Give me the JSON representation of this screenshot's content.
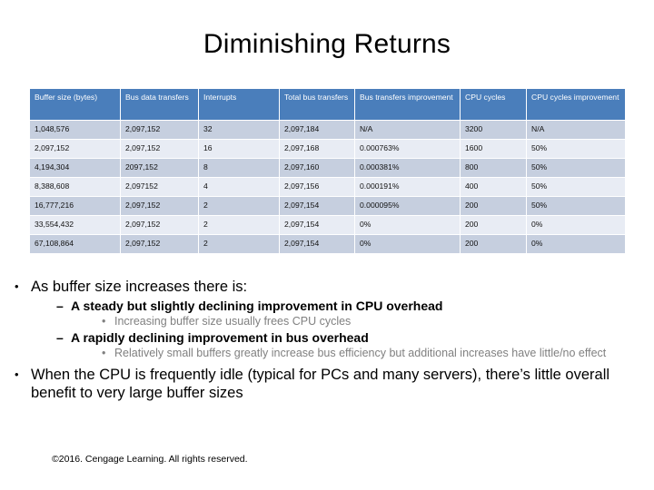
{
  "slide": {
    "title": "Diminishing Returns",
    "footer": "©2016. Cengage Learning. All rights reserved."
  },
  "table": {
    "headers": [
      "Buffer size (bytes)",
      "Bus data transfers",
      "Interrupts",
      "Total bus transfers",
      "Bus transfers improvement",
      "CPU cycles",
      "CPU cycles improvement"
    ],
    "header_colors": {
      "background": "#4a7ebb",
      "text": "#ffffff"
    },
    "row_colors": {
      "odd": "#c6cfdf",
      "even": "#e8ecf4"
    },
    "rows": [
      {
        "buffer_size": "1,048,576",
        "bus_data_transfers": "2,097,152",
        "interrupts": "32",
        "total_bus_transfers": "2,097,184",
        "bus_transfers_improvement": "N/A",
        "cpu_cycles": "3200",
        "cpu_cycles_improvement": "N/A"
      },
      {
        "buffer_size": "2,097,152",
        "bus_data_transfers": "2,097,152",
        "interrupts": "16",
        "total_bus_transfers": "2,097,168",
        "bus_transfers_improvement": "0.000763%",
        "cpu_cycles": "1600",
        "cpu_cycles_improvement": "50%"
      },
      {
        "buffer_size": "4,194,304",
        "bus_data_transfers": "2097,152",
        "interrupts": "8",
        "total_bus_transfers": "2,097,160",
        "bus_transfers_improvement": "0.000381%",
        "cpu_cycles": "800",
        "cpu_cycles_improvement": "50%"
      },
      {
        "buffer_size": "8,388,608",
        "bus_data_transfers": "2,097152",
        "interrupts": "4",
        "total_bus_transfers": "2,097,156",
        "bus_transfers_improvement": "0.000191%",
        "cpu_cycles": "400",
        "cpu_cycles_improvement": "50%"
      },
      {
        "buffer_size": "16,777,216",
        "bus_data_transfers": "2,097,152",
        "interrupts": "2",
        "total_bus_transfers": "2,097,154",
        "bus_transfers_improvement": "0.000095%",
        "cpu_cycles": "200",
        "cpu_cycles_improvement": "50%"
      },
      {
        "buffer_size": "33,554,432",
        "bus_data_transfers": "2,097,152",
        "interrupts": "2",
        "total_bus_transfers": "2,097,154",
        "bus_transfers_improvement": "0%",
        "cpu_cycles": "200",
        "cpu_cycles_improvement": "0%"
      },
      {
        "buffer_size": "67,108,864",
        "bus_data_transfers": "2,097,152",
        "interrupts": "2",
        "total_bus_transfers": "2,097,154",
        "bus_transfers_improvement": "0%",
        "cpu_cycles": "200",
        "cpu_cycles_improvement": "0%"
      }
    ]
  },
  "bullets": {
    "b1": {
      "marker": "•",
      "text": "As buffer size increases there is:"
    },
    "b1s1": {
      "marker": "–",
      "text": "A steady but slightly declining improvement in CPU overhead"
    },
    "b1s1s1": {
      "marker": "•",
      "text": "Increasing buffer size usually frees CPU cycles"
    },
    "b1s2": {
      "marker": "–",
      "text": "A rapidly declining improvement in bus overhead"
    },
    "b1s2s1": {
      "marker": "•",
      "text": "Relatively small buffers greatly increase bus efficiency but additional increases have little/no effect"
    },
    "b2": {
      "marker": "•",
      "text": "When the CPU is frequently idle (typical for PCs and many servers), there’s little overall benefit to very large buffer sizes"
    }
  }
}
